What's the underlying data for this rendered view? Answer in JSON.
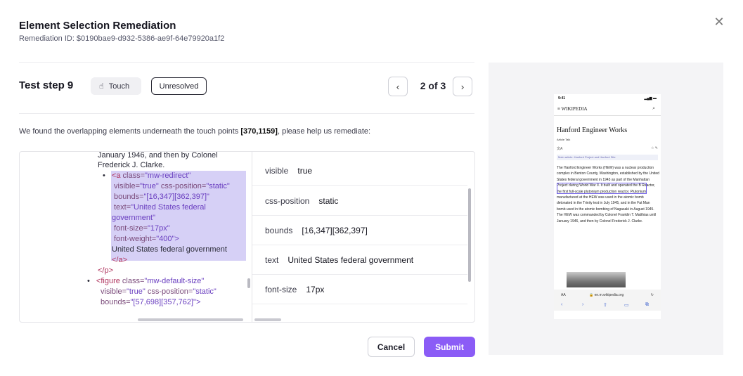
{
  "modal": {
    "title": "Element Selection Remediation",
    "remediation_id": "Remediation ID: $0190bae9-d932-5386-ae9f-64e79920a1f2",
    "close_glyph": "✕"
  },
  "step": {
    "title": "Test step 9",
    "action_label": "Touch",
    "status_label": "Unresolved",
    "pager_text": "2 of 3",
    "prev_glyph": "‹",
    "next_glyph": "›"
  },
  "info": {
    "prefix": "We found the overlapping elements underneath the touch points ",
    "points": "[370,1159]",
    "suffix": ", please help us remediate:"
  },
  "code": {
    "line1": "January 1946, and then by Colonel",
    "line2": "Frederick J. Clarke.",
    "a_bullet": "•",
    "a_open": "<a",
    "a_class_attr": " class=",
    "a_class_val": "\"mw-redirect\"",
    "a_visible_attr": "visible=",
    "a_visible_val": "\"true\"",
    "a_csspos_attr": " css-position=",
    "a_csspos_val": "\"static\"",
    "a_bounds_attr": "bounds=",
    "a_bounds_val": "\"[16,347][362,397]\"",
    "a_text_attr": "text=",
    "a_text_val1": "\"United States federal",
    "a_text_val2": "government\"",
    "a_fontsize_attr": "font-size=",
    "a_fontsize_val": "\"17px\"",
    "a_fontweight_attr": "font-weight=",
    "a_fontweight_val": "\"400\">",
    "a_text": "United States federal government",
    "a_close": "</a>",
    "p_close": "</p>",
    "fig_bullet": "•",
    "fig_open": "<figure",
    "fig_class_attr": " class=",
    "fig_class_val": "\"mw-default-size\"",
    "fig_visible_attr": "visible=",
    "fig_visible_val": "\"true\"",
    "fig_csspos_attr": " css-position=",
    "fig_csspos_val": "\"static\"",
    "fig_bounds_attr": "bounds=",
    "fig_bounds_val": "\"[57,698][357,762]\">"
  },
  "properties": [
    {
      "key": "visible",
      "value": "true"
    },
    {
      "key": "css-position",
      "value": "static"
    },
    {
      "key": "bounds",
      "value": "[16,347][362,397]"
    },
    {
      "key": "text",
      "value": "United States federal government"
    },
    {
      "key": "font-size",
      "value": "17px"
    }
  ],
  "footer": {
    "cancel_label": "Cancel",
    "submit_label": "Submit"
  },
  "phone": {
    "time": "9:41",
    "signal": "▂▄▆ ▬",
    "wiki_logo": "≡  WIKIPEDIA",
    "search_glyph": "⌕",
    "article_title": "Hanford Engineer Works",
    "tabs": "Article   Talk",
    "tools_left": "文A",
    "tools_right": "☆  ✎",
    "note": "Main article: Hanford Project and Hanford Site",
    "body": "The Hanford Engineer Works (HEW) was a nuclear production complex in Benton County, Washington, established by the United States federal government in 1943 as part of the Manhattan Project during World War II. It built and operated the B Reactor, the first full-scale plutonium production reactor. Plutonium manufactured at the HEW was used in the atomic bomb detonated in the Trinity test in July 1945, and in the Fat Man bomb used in the atomic bombing of Nagasaki in August 1945. The HEW was commanded by Colonel Franklin T. Matthias until January 1946, and then by Colonel Frederick J. Clarke.",
    "url_left": "AA",
    "url": "🔒 en.m.wikipedia.org",
    "url_right": "↻",
    "nav_back": "‹",
    "nav_fwd": "›",
    "nav_share": "⇧",
    "nav_books": "▭",
    "nav_tabs": "⧉"
  },
  "colors": {
    "accent": "#8b5cf6",
    "highlight": "#d6d0f6",
    "tag": "#b0345e",
    "value": "#6a3fc0"
  }
}
